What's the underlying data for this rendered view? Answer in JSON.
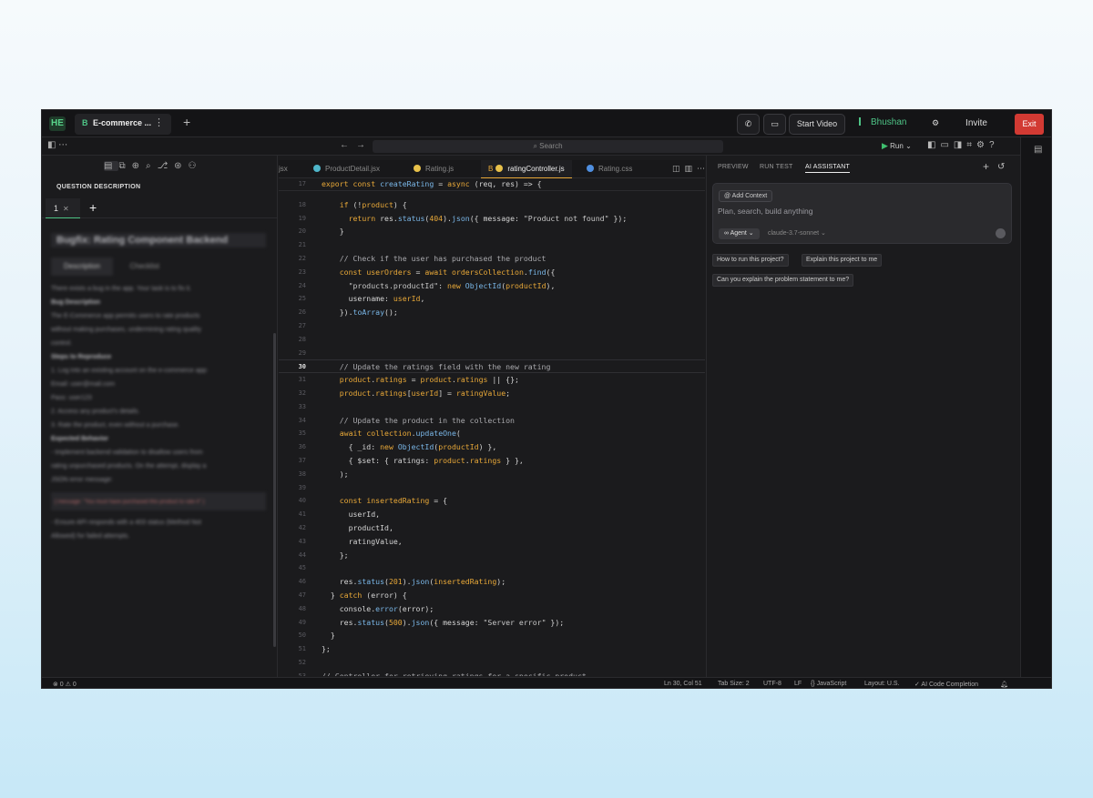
{
  "topbar": {
    "logo": "HE",
    "project_badge": "B",
    "project_title": "E-commerce ...",
    "more": "⋮",
    "add": "+",
    "start_video": "Start Video",
    "user": "Bhushan",
    "invite": "Invite",
    "exit": "Exit"
  },
  "toolbar": {
    "search_placeholder": "Search",
    "run": "Run"
  },
  "left_panel": {
    "section_title": "QUESTION DESCRIPTION",
    "tab_label": "1",
    "add_tab": "+",
    "problem_title": "Bugfix: Rating Component Backend",
    "desc_tabs": [
      "Description",
      "Checklist"
    ],
    "body_lines": [
      {
        "t": "There exists a bug in the app. Your task is to fix it.",
        "h": false
      },
      {
        "t": "Bug Description",
        "h": true
      },
      {
        "t": "The E-Commerce app permits users to rate products",
        "h": false
      },
      {
        "t": "without making purchases, undermining rating quality",
        "h": false
      },
      {
        "t": "control.",
        "h": false
      },
      {
        "t": "Steps to Reproduce",
        "h": true
      },
      {
        "t": "1. Log into an existing account on the e-commerce app:",
        "h": false
      },
      {
        "t": "   Email: user@mail.com",
        "h": false
      },
      {
        "t": "   Pass: user123",
        "h": false
      },
      {
        "t": "2. Access any product's details.",
        "h": false
      },
      {
        "t": "3. Rate the product, even without a purchase.",
        "h": false
      },
      {
        "t": "Expected Behavior",
        "h": true
      },
      {
        "t": "- Implement backend validation to disallow users from",
        "h": false
      },
      {
        "t": "  rating unpurchased products. On the attempt, display a",
        "h": false
      },
      {
        "t": "  JSON error message:",
        "h": false
      }
    ],
    "code_snippet": "{ message: \"You must have purchased this product to rate it\" }",
    "body_tail": [
      "- Ensure API responds with a 403 status (Method Not",
      "  Allowed) for failed attempts."
    ]
  },
  "editor_tabs": [
    {
      "label": "jsx",
      "icon_color": "#5aa6e0",
      "active": false
    },
    {
      "label": "ProductDetail.jsx",
      "icon_color": "#4fb6c9",
      "active": false
    },
    {
      "label": "Rating.js",
      "icon_color": "#e8c14a",
      "active": false
    },
    {
      "label": "ratingController.js",
      "icon_color": "#e8c14a",
      "active": true,
      "badge": "B"
    },
    {
      "label": "Rating.css",
      "icon_color": "#4f8fe0",
      "active": false
    }
  ],
  "code_lines": [
    {
      "n": "17",
      "html": "<span class='k'>export</span> <span class='k'>const</span> <span class='f'>createRating</span> = <span class='k'>async</span> (req, res) =&gt; {",
      "sticky": true
    },
    {
      "n": "18",
      "html": "    <span class='k'>if</span> (!<span class='v'>product</span>) {"
    },
    {
      "n": "19",
      "html": "      <span class='k'>return</span> res.<span class='f'>status</span>(<span class='n'>404</span>).<span class='f'>json</span>({ message: <span class='s'>\"Product not found\"</span> });"
    },
    {
      "n": "20",
      "html": "    }"
    },
    {
      "n": "21",
      "html": ""
    },
    {
      "n": "22",
      "html": "    <span class='c'>// Check if the user has purchased the product</span>"
    },
    {
      "n": "23",
      "html": "    <span class='k'>const</span> <span class='v'>userOrders</span> = <span class='k'>await</span> <span class='v'>ordersCollection</span>.<span class='f'>find</span>({"
    },
    {
      "n": "24",
      "html": "      <span class='s'>\"products.productId\"</span>: <span class='k'>new</span> <span class='f'>ObjectId</span>(<span class='v'>productId</span>),"
    },
    {
      "n": "25",
      "html": "      username: <span class='v'>userId</span>,"
    },
    {
      "n": "26",
      "html": "    }).<span class='f'>toArray</span>();"
    },
    {
      "n": "27",
      "html": ""
    },
    {
      "n": "28",
      "html": ""
    },
    {
      "n": "29",
      "html": ""
    },
    {
      "n": "30",
      "html": "    <span class='c'>// Update the ratings field with the new rating</span>",
      "current": true
    },
    {
      "n": "31",
      "html": "    <span class='v'>product</span>.<span class='v'>ratings</span> = <span class='v'>product</span>.<span class='v'>ratings</span> || {};"
    },
    {
      "n": "32",
      "html": "    <span class='v'>product</span>.<span class='v'>ratings</span>[<span class='v'>userId</span>] = <span class='v'>ratingValue</span>;"
    },
    {
      "n": "33",
      "html": ""
    },
    {
      "n": "34",
      "html": "    <span class='c'>// Update the product in the collection</span>"
    },
    {
      "n": "35",
      "html": "    <span class='k'>await</span> <span class='v'>collection</span>.<span class='f'>updateOne</span>("
    },
    {
      "n": "36",
      "html": "      { _id: <span class='k'>new</span> <span class='f'>ObjectId</span>(<span class='v'>productId</span>) },"
    },
    {
      "n": "37",
      "html": "      { $set: { ratings: <span class='v'>product</span>.<span class='v'>ratings</span> } },"
    },
    {
      "n": "38",
      "html": "    );"
    },
    {
      "n": "39",
      "html": ""
    },
    {
      "n": "40",
      "html": "    <span class='k'>const</span> <span class='v'>insertedRating</span> = {"
    },
    {
      "n": "41",
      "html": "      userId,"
    },
    {
      "n": "42",
      "html": "      productId,"
    },
    {
      "n": "43",
      "html": "      ratingValue,"
    },
    {
      "n": "44",
      "html": "    };"
    },
    {
      "n": "45",
      "html": ""
    },
    {
      "n": "46",
      "html": "    res.<span class='f'>status</span>(<span class='n'>201</span>).<span class='f'>json</span>(<span class='v'>insertedRating</span>);"
    },
    {
      "n": "47",
      "html": "  } <span class='k'>catch</span> (error) {"
    },
    {
      "n": "48",
      "html": "    console.<span class='f'>error</span>(error);"
    },
    {
      "n": "49",
      "html": "    res.<span class='f'>status</span>(<span class='n'>500</span>).<span class='f'>json</span>({ message: <span class='s'>\"Server error\"</span> });"
    },
    {
      "n": "50",
      "html": "  }"
    },
    {
      "n": "51",
      "html": "};"
    },
    {
      "n": "52",
      "html": ""
    },
    {
      "n": "53",
      "html": "<span class='c'>// Controller for retrieving ratings for a specific product</span>"
    }
  ],
  "right_panel": {
    "tabs": [
      "PREVIEW",
      "RUN TEST",
      "AI ASSISTANT"
    ],
    "add_context": "Add Context",
    "placeholder": "Plan, search, build anything",
    "agent": "Agent",
    "model": "claude-3.7-sonnet",
    "suggestions": [
      "How to run this project?",
      "Explain this project to me",
      "Can you explain the problem statement to me?"
    ]
  },
  "status_bar": {
    "problems": "⊗ 0 ⚠ 0",
    "position": "Ln 30, Col 51",
    "tab_size": "Tab Size: 2",
    "encoding": "UTF-8",
    "eol": "LF",
    "language": "{} JavaScript",
    "layout": "Layout: U.S.",
    "ai": "✓ AI Code Completion"
  }
}
